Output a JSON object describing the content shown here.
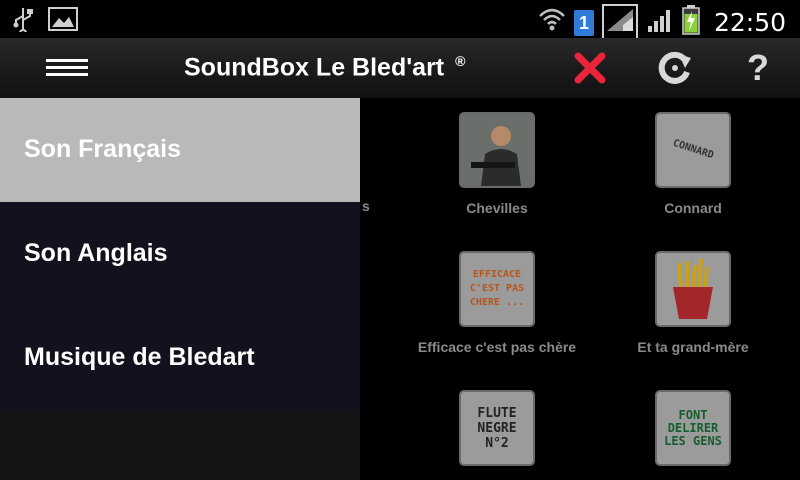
{
  "statusbar": {
    "clock": "22:50",
    "sim_badge": "1",
    "icons": [
      "usb-icon",
      "image-icon",
      "wifi-icon",
      "sim-icon",
      "signal-icon",
      "signal-icon",
      "battery-charging-icon"
    ]
  },
  "actionbar": {
    "title": "SoundBox Le Bled'art",
    "registered_mark": "®",
    "icons": [
      "menu-icon",
      "close-icon",
      "refresh-icon",
      "help-icon"
    ],
    "close_color": "#e8253a"
  },
  "drawer": {
    "items": [
      {
        "label": "Son Français",
        "selected": true
      },
      {
        "label": "Son Anglais",
        "selected": false
      },
      {
        "label": "Musique de Bledart",
        "selected": false
      }
    ]
  },
  "grid": {
    "partial_label": "s",
    "items": [
      {
        "label": "Chevilles",
        "thumb_text": ""
      },
      {
        "label": "Connard",
        "thumb_text": "CONNARD"
      },
      {
        "label": "Efficace c'est pas chère",
        "thumb_text": "EFFICACE C'EST PAS CHERE ..."
      },
      {
        "label": "Et ta grand-mère",
        "thumb_text": ""
      },
      {
        "label": "",
        "thumb_text": "FLUTE NEGRE N°2"
      },
      {
        "label": "",
        "thumb_text": "FONT DELIRER LES GENS"
      }
    ]
  }
}
